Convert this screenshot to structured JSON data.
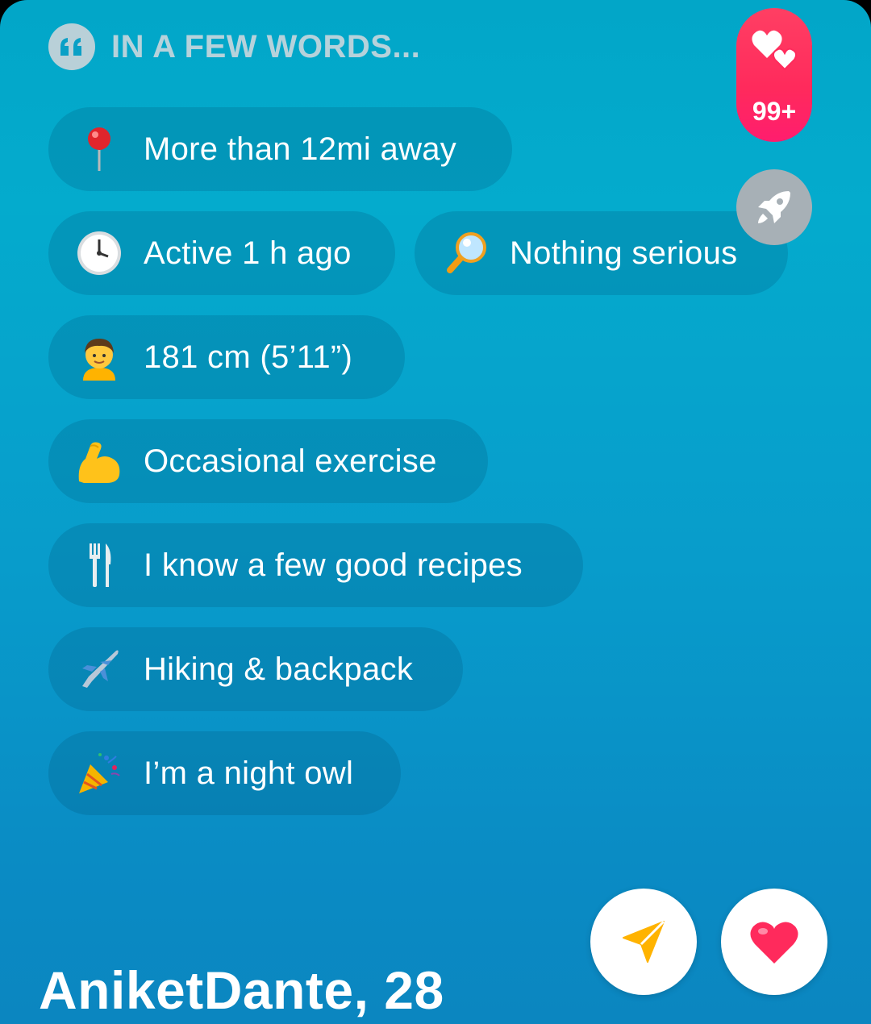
{
  "header": {
    "title": "IN A FEW WORDS..."
  },
  "likes": {
    "count": "99+"
  },
  "chips": [
    {
      "icon": "round-pushpin-icon",
      "label": "More than 12mi away"
    },
    {
      "icon": "clock-icon",
      "label": "Active 1 h ago"
    },
    {
      "icon": "magnifying-glass-icon",
      "label": "Nothing serious"
    },
    {
      "icon": "man-icon",
      "label": "181 cm (5’11”)"
    },
    {
      "icon": "flexed-biceps-icon",
      "label": "Occasional exercise"
    },
    {
      "icon": "fork-and-knife-icon",
      "label": "I know a few good recipes"
    },
    {
      "icon": "airplane-icon",
      "label": "Hiking & backpack"
    },
    {
      "icon": "party-popper-icon",
      "label": "I’m a night owl"
    }
  ],
  "profile": {
    "name_age": "AniketDante, 28"
  },
  "colors": {
    "like": "#ff2a5c",
    "send": "#ffb300",
    "card": "#04abcd"
  }
}
